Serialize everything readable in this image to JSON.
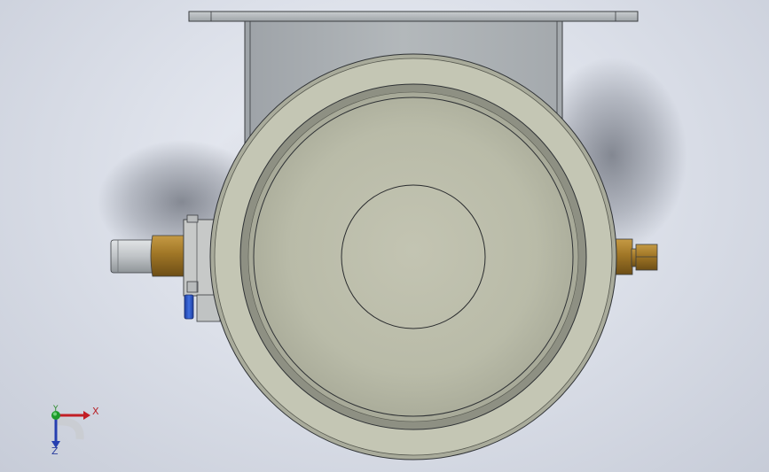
{
  "viewport": {
    "background": "#dde1ea",
    "colors": {
      "bracket": "#a9afb3",
      "housing": "#c4c5b2",
      "bowl": "#b7b9a6",
      "brass": "#a57a2e",
      "steel": "#c2c6c9",
      "blue_fitting": "#2c56c6"
    }
  },
  "triad": {
    "x_label": "X",
    "y_label": "Y",
    "z_label": "Z",
    "colors": {
      "x": "#c21e25",
      "y": "#1d9a2a",
      "z": "#263fb0"
    }
  },
  "icons": [
    "axis-triad-icon",
    "flange-bracket-icon",
    "dome-housing-icon",
    "brass-fitting-icon",
    "hex-nut-icon",
    "blue-fitting-icon"
  ]
}
